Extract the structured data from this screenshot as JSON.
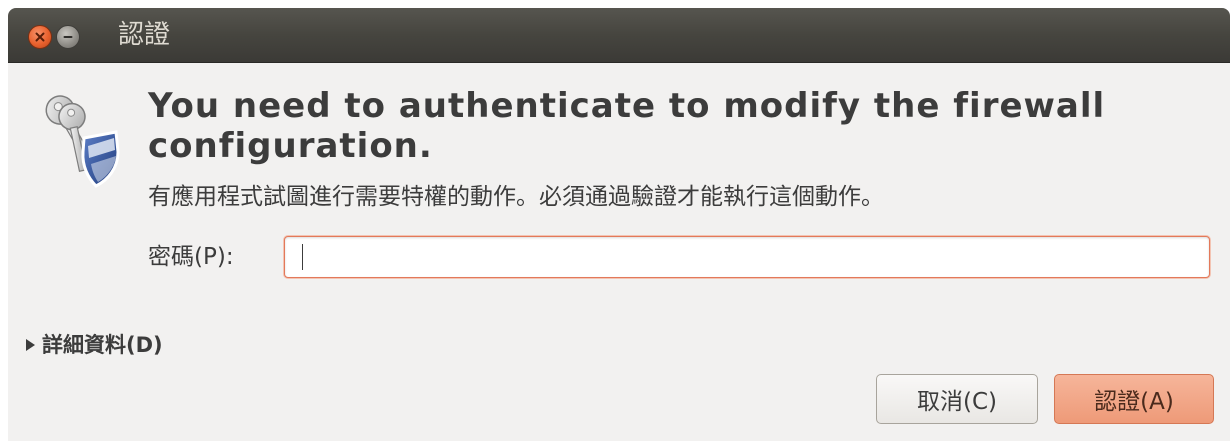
{
  "window": {
    "title": "認證",
    "controls": {
      "close_icon": "close-icon",
      "minimize_icon": "minimize-icon"
    }
  },
  "dialog": {
    "icon": "keys-shield-icon",
    "heading": "You need to authenticate to modify the firewall configuration.",
    "description": "有應用程式試圖進行需要特權的動作。必須通過驗證才能執行這個動作。",
    "password": {
      "label": "密碼(P):",
      "value": "",
      "placeholder": ""
    },
    "details": {
      "label": "詳細資料(D)",
      "expanded": false
    },
    "buttons": {
      "cancel_label": "取消(C)",
      "authenticate_label": "認證(A)"
    }
  },
  "colors": {
    "titlebar": "#3b3a36",
    "dialog_bg": "#f2f1f0",
    "accent": "#ee9a78",
    "focus_border": "#e3795a"
  }
}
